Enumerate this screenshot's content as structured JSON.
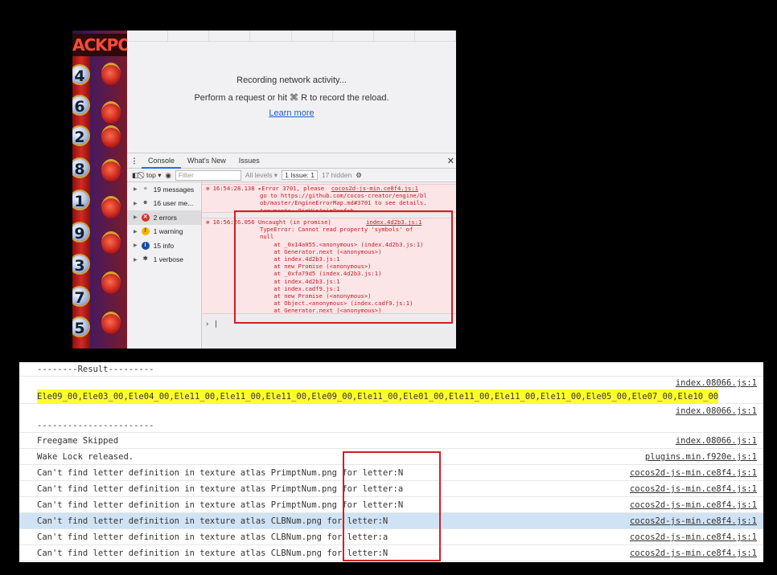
{
  "game": {
    "banner": "ACKPO",
    "balls": [
      "4",
      "6",
      "2",
      "8",
      "1",
      "9",
      "3",
      "7",
      "5"
    ]
  },
  "network": {
    "recording": "Recording network activity...",
    "instruction": "Perform a request or hit ⌘ R to record the reload.",
    "learn_more": "Learn more"
  },
  "drawer_tabs": [
    "Console",
    "What's New",
    "Issues"
  ],
  "toolbar": {
    "context": "top ▾",
    "filter_placeholder": "Filter",
    "levels": "All levels ▾",
    "issue": "1 Issue: 1",
    "hidden": "17 hidden"
  },
  "sidebar": [
    {
      "icon": "list-icon",
      "label": "19 messages"
    },
    {
      "icon": "user-icon",
      "label": "16 user me..."
    },
    {
      "icon": "error-icon",
      "label": "2 errors"
    },
    {
      "icon": "warning-icon",
      "label": "1 warning"
    },
    {
      "icon": "info-icon",
      "label": "15 info"
    },
    {
      "icon": "bug-icon",
      "label": "1 verbose"
    }
  ],
  "log_entries": [
    {
      "time": "16:54:28.138",
      "text": "▸Error 3701, please",
      "source": "cocos2d-js-min.ce8f4.js:1",
      "lines": [
        "go to https://github.com/cocos-creator/engine/bl",
        "ob/master/EngineErrorMap.md#3701 to see details.",
        "Arguments: BigWinAnimPrefab"
      ]
    },
    {
      "time": "16:56:26.056",
      "text": "Uncaught (in promise)",
      "source": "index.4d2b3.js:1",
      "lines": [
        "TypeError: Cannot read property 'symbols' of",
        "null",
        "    at _0x14a055.<anonymous> (index.4d2b3.js:1)",
        "    at Generator.next (<anonymous>)",
        "    at index.4d2b3.js:1",
        "    at new Promise (<anonymous>)",
        "    at _0xfa79d5 (index.4d2b3.js:1)",
        "    at index.4d2b3.js:1",
        "    at index.cadf9.js:1",
        "    at new Promise (<anonymous>)",
        "    at Object.<anonymous> (index.cadf9.js:1)",
        "    at Generator.next (<anonymous>)"
      ]
    }
  ],
  "console_rows": [
    {
      "msg": "--------Result---------",
      "src": ""
    },
    {
      "msg": "",
      "src": "index.08066.js:1"
    },
    {
      "msg": "Ele09_00,Ele03_00,Ele04_00,Ele11_00,Ele11_00,Ele11_00,Ele09_00,Ele11_00,Ele01_00,Ele11_00,Ele11_00,Ele11_00,Ele05_00,Ele07_00,Ele10_00",
      "src": ""
    },
    {
      "msg": "",
      "src": "index.08066.js:1"
    },
    {
      "msg": "-----------------------",
      "src": ""
    },
    {
      "msg": "Freegame Skipped",
      "src": "index.08066.js:1"
    },
    {
      "msg": "Wake Lock released.",
      "src": "plugins.min.f920e.js:1"
    },
    {
      "msg": "Can't find letter definition in texture atlas PrimptNum.png for letter:N",
      "src": "cocos2d-js-min.ce8f4.js:1"
    },
    {
      "msg": "Can't find letter definition in texture atlas PrimptNum.png for letter:a",
      "src": "cocos2d-js-min.ce8f4.js:1"
    },
    {
      "msg": "Can't find letter definition in texture atlas PrimptNum.png for letter:N",
      "src": "cocos2d-js-min.ce8f4.js:1"
    },
    {
      "msg": "Can't find letter definition in texture atlas CLBNum.png for letter:N",
      "src": "cocos2d-js-min.ce8f4.js:1"
    },
    {
      "msg": "Can't find letter definition in texture atlas CLBNum.png for letter:a",
      "src": "cocos2d-js-min.ce8f4.js:1"
    },
    {
      "msg": "Can't find letter definition in texture atlas CLBNum.png for letter:N",
      "src": "cocos2d-js-min.ce8f4.js:1"
    }
  ],
  "colors": {
    "error": "#c0202a",
    "highlight_box": "#d12020",
    "selected_row": "#cfe3f5",
    "yellow": "#ffff2e"
  }
}
